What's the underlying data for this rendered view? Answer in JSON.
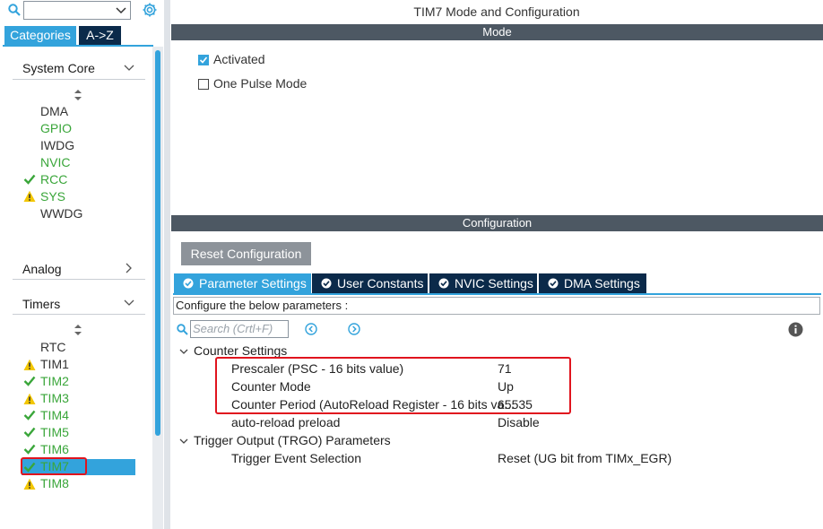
{
  "left_panel": {
    "search_value": "",
    "tabs": {
      "categories": "Categories",
      "az": "A->Z"
    },
    "system_core": {
      "title": "System Core",
      "items": [
        {
          "label": "DMA",
          "status": "none"
        },
        {
          "label": "GPIO",
          "status": "none"
        },
        {
          "label": "IWDG",
          "status": "none"
        },
        {
          "label": "NVIC",
          "status": "none"
        },
        {
          "label": "RCC",
          "status": "ok"
        },
        {
          "label": "SYS",
          "status": "warning"
        },
        {
          "label": "WWDG",
          "status": "none"
        }
      ]
    },
    "analog": {
      "title": "Analog"
    },
    "timers": {
      "title": "Timers",
      "items": [
        {
          "label": "RTC",
          "status": "none"
        },
        {
          "label": "TIM1",
          "status": "warning"
        },
        {
          "label": "TIM2",
          "status": "ok"
        },
        {
          "label": "TIM3",
          "status": "warning"
        },
        {
          "label": "TIM4",
          "status": "ok"
        },
        {
          "label": "TIM5",
          "status": "ok"
        },
        {
          "label": "TIM6",
          "status": "ok"
        },
        {
          "label": "TIM7",
          "status": "ok",
          "selected": true
        },
        {
          "label": "TIM8",
          "status": "warning"
        }
      ]
    }
  },
  "main": {
    "title": "TIM7 Mode and Configuration",
    "mode": {
      "header": "Mode",
      "activated": {
        "label": "Activated",
        "checked": true
      },
      "one_pulse": {
        "label": "One Pulse Mode",
        "checked": false
      }
    },
    "configuration": {
      "header": "Configuration",
      "reset_button": "Reset Configuration",
      "tabs": [
        "Parameter Settings",
        "User Constants",
        "NVIC Settings",
        "DMA Settings"
      ],
      "configure_text": "Configure the below parameters :",
      "search_placeholder": "Search (Crtl+F)",
      "groups": [
        {
          "title": "Counter Settings",
          "params": [
            {
              "name": "Prescaler (PSC - 16 bits value)",
              "value": "71"
            },
            {
              "name": "Counter Mode",
              "value": "Up"
            },
            {
              "name": "Counter Period (AutoReload Register - 16 bits va...",
              "value": "65535"
            },
            {
              "name": "auto-reload preload",
              "value": "Disable"
            }
          ]
        },
        {
          "title": "Trigger Output (TRGO) Parameters",
          "params": [
            {
              "name": "Trigger Event Selection",
              "value": "Reset (UG bit from TIMx_EGR)"
            }
          ]
        }
      ]
    }
  },
  "colors": {
    "accent": "#33a3dc",
    "dark_tab": "#0b2a4a",
    "band": "#4d5863",
    "ok": "#3aa63a",
    "warning": "#f2c600",
    "highlight": "#e0141e"
  }
}
